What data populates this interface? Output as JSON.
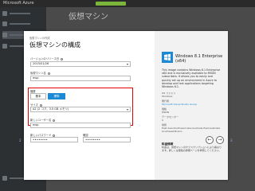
{
  "topbar": {
    "brand": "Microsoft Azure",
    "pill": "",
    "right": ""
  },
  "background": {
    "title": "仮想マシン"
  },
  "wizard": {
    "kicker": "仮想マシンの作成",
    "title": "仮想マシンの構成",
    "fields": {
      "version_label": "バージョンのリリース日",
      "version_value": "2015/01/26",
      "vmname_label": "仮想マシン名",
      "vmname_value": "msp",
      "tier_label": "階層",
      "tier_basic": "基本",
      "tier_standard": "標準",
      "size_label": "サイズ",
      "size_value": "A2 (2 コア、3.5 GB メモリ)",
      "username_label": "新しいユーザー名",
      "username_value": "msp",
      "password_label": "新しいパスワード",
      "confirm_label": "確認",
      "password_value": "••••••••",
      "confirm_value": "••••••••"
    }
  },
  "info": {
    "product_name": "Windows 8.1 Enterprise (x64)",
    "description": "This image contains Windows 8.1 Enterprise x64 and is exclusively available to MSDN subscribers. It allows you to easily and quickly set up an environment in Azure to develop and test applications targeting Windows 8.1.",
    "os_family_label": "OS ファミリ",
    "os_family": "Windows",
    "publisher_label": "発行者",
    "publisher": "Microsoft Visual Studio Group",
    "pricing_label": "価格",
    "pricing": "MSDN",
    "datacenter_label": "データセンター",
    "datacenter": "0",
    "regions_label": "場所",
    "regions": "East Asia;Southeast Asia;Australia East;Australia Southeast;Brazil...",
    "notice_title": "料金情報",
    "notice": "料金は、仮想マシンのサブスクリプションにより異なります。詳しくは価格の詳細ページを参照してください。"
  },
  "nav": {
    "prev": "←",
    "next": "→",
    "step": "2",
    "step_next": "3"
  },
  "colors": {
    "accent": "#1b89d4",
    "highlight": "#e20000"
  }
}
